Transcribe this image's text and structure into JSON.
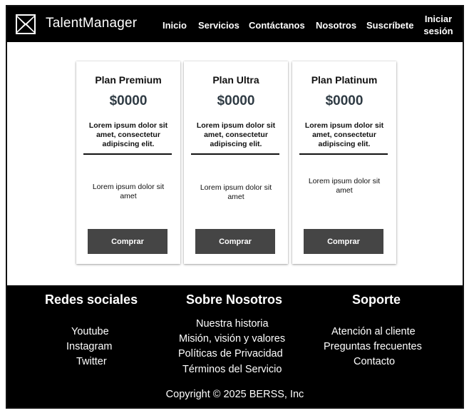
{
  "header": {
    "brand": "TalentManager",
    "logo_icon": "x-box-logo-icon",
    "nav": [
      "Inicio",
      "Servicios",
      "Contáctanos",
      "Nosotros",
      "Suscríbete"
    ],
    "login_line1": "Iniciar",
    "login_line2": "sesión",
    "colors": {
      "background": "#000000",
      "text": "#ffffff"
    }
  },
  "plans": [
    {
      "title": "Plan Premium",
      "price": "$0000",
      "description": "Lorem ipsum dolor sit amet, consectetur adipiscing elit.",
      "feature": "Lorem ipsum dolor sit amet",
      "button": "Comprar"
    },
    {
      "title": "Plan Ultra",
      "price": "$0000",
      "description": "Lorem ipsum dolor sit amet, consectetur adipiscing elit.",
      "feature": "Lorem ipsum dolor sit amet",
      "button": "Comprar"
    },
    {
      "title": "Plan Platinum",
      "price": "$0000",
      "description": "Lorem ipsum dolor sit amet, consectetur adipiscing elit.",
      "feature": "Lorem ipsum dolor sit amet",
      "button": "Comprar"
    }
  ],
  "footer": {
    "social": {
      "heading": "Redes sociales",
      "links": [
        "Youtube",
        "Instagram",
        "Twitter"
      ]
    },
    "about": {
      "heading": "Sobre Nosotros",
      "links": [
        "Nuestra historia",
        "Misión, visión y valores",
        "Políticas de Privacidad",
        "Términos del Servicio"
      ]
    },
    "support": {
      "heading": "Soporte",
      "links": [
        "Atención al cliente",
        "Preguntas frecuentes",
        "Contacto"
      ]
    },
    "copyright": "Copyright © 2025 BERSS, Inc"
  },
  "colors": {
    "button": "#454545",
    "price": "#2f3b44",
    "footer_bg": "#000000"
  }
}
